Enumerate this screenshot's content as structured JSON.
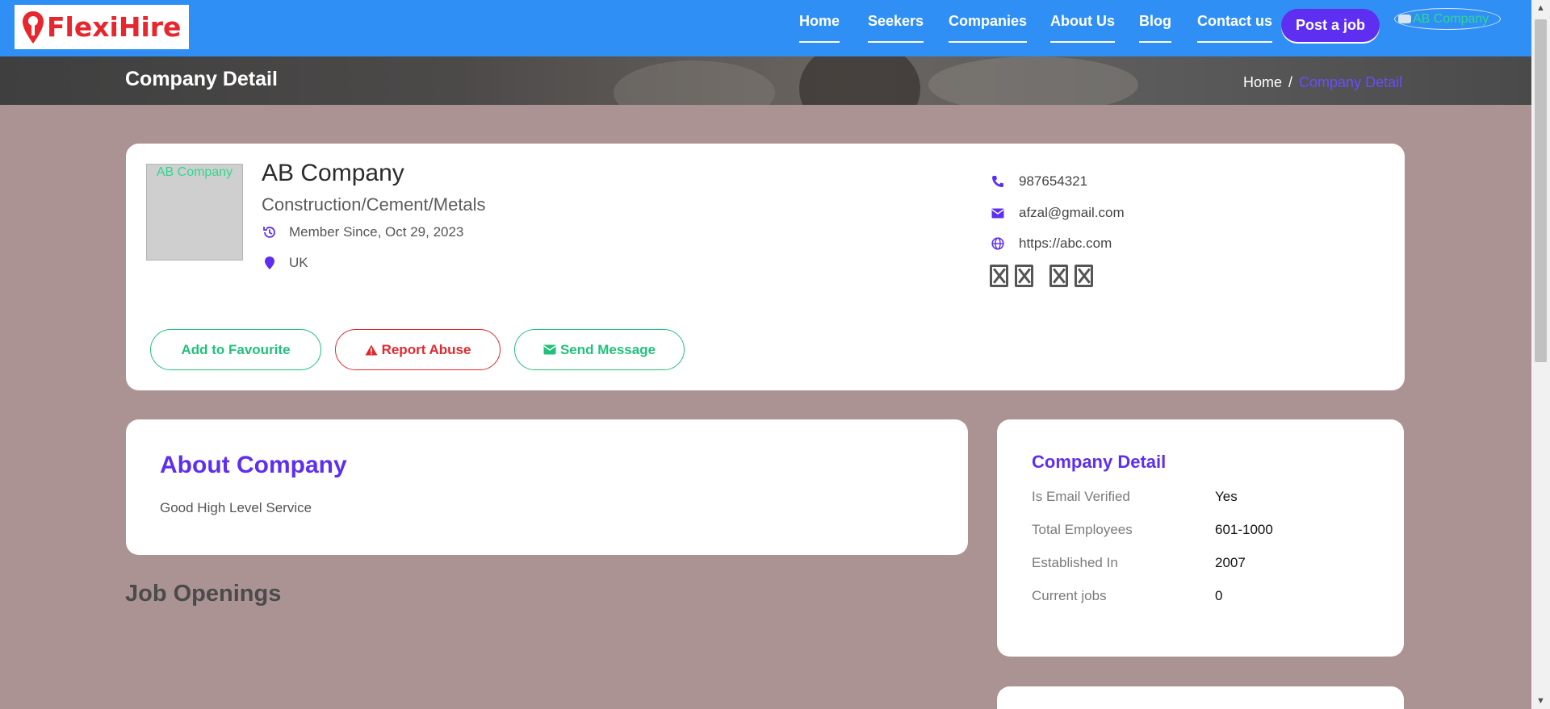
{
  "brand": {
    "name": "FlexiHire",
    "color": "#e8262d"
  },
  "colors": {
    "header": "#2f8ff5",
    "accent": "#5e2ff0",
    "green": "#21c17b",
    "red": "#e0292f",
    "page_bg": "#ab9393"
  },
  "nav": {
    "items": [
      "Home",
      "Seekers",
      "Companies",
      "About Us",
      "Blog",
      "Contact us"
    ],
    "post_job": "Post a job",
    "user_label": "AB Company"
  },
  "banner": {
    "title": "Company Detail",
    "breadcrumb": {
      "home": "Home",
      "separator": "/",
      "current": "Company Detail"
    }
  },
  "company": {
    "logo_alt": "AB Company",
    "name": "AB Company",
    "industry": "Construction/Cement/Metals",
    "member_since": "Member Since, Oct 29, 2023",
    "location": "UK",
    "phone": "987654321",
    "email": "afzal@gmail.com",
    "website": "https://abc.com",
    "social_icons": [
      "missing-glyph-icon",
      "missing-glyph-icon",
      "missing-glyph-icon",
      "missing-glyph-icon"
    ]
  },
  "actions": {
    "favourite": "Add to Favourite",
    "report": "Report Abuse",
    "message": "Send Message"
  },
  "about": {
    "heading": "About Company",
    "text": "Good High Level Service"
  },
  "jobs": {
    "heading": "Job Openings"
  },
  "details": {
    "heading": "Company Detail",
    "rows": [
      {
        "label": "Is Email Verified",
        "value": "Yes"
      },
      {
        "label": "Total Employees",
        "value": "601-1000"
      },
      {
        "label": "Established In",
        "value": "2007"
      },
      {
        "label": "Current jobs",
        "value": "0"
      }
    ]
  }
}
